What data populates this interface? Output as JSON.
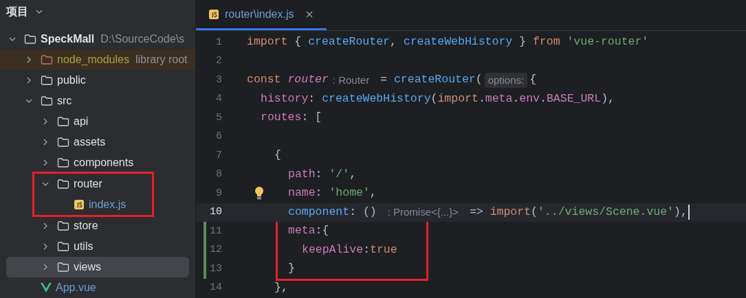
{
  "sidebar": {
    "title": "项目",
    "tree": [
      {
        "name": "SpeckMall",
        "hint": "D:\\SourceCode\\s",
        "kind": "folder",
        "expanded": true,
        "selected": false,
        "boxed": false,
        "children": [
          {
            "name": "node_modules",
            "hint": "library root",
            "kind": "excluded",
            "expanded": false,
            "selected": false,
            "boxed": false
          },
          {
            "name": "public",
            "kind": "folder",
            "expanded": false,
            "selected": false,
            "boxed": false
          },
          {
            "name": "src",
            "kind": "folder",
            "expanded": true,
            "selected": false,
            "boxed": false,
            "children": [
              {
                "name": "api",
                "kind": "folder",
                "expanded": false,
                "selected": false,
                "boxed": false
              },
              {
                "name": "assets",
                "kind": "folder",
                "expanded": false,
                "selected": false,
                "boxed": false
              },
              {
                "name": "components",
                "kind": "folder",
                "expanded": false,
                "selected": false,
                "boxed": false
              },
              {
                "name": "router",
                "kind": "folder",
                "expanded": true,
                "selected": false,
                "boxed": true,
                "children": [
                  {
                    "name": "index.js",
                    "kind": "js",
                    "selected": false,
                    "boxed": false
                  }
                ]
              },
              {
                "name": "store",
                "kind": "folder",
                "expanded": false,
                "selected": false,
                "boxed": false
              },
              {
                "name": "utils",
                "kind": "folder",
                "expanded": false,
                "selected": false,
                "boxed": false
              },
              {
                "name": "views",
                "kind": "folder",
                "expanded": false,
                "selected": true,
                "boxed": false
              }
            ]
          },
          {
            "name": "App.vue",
            "kind": "vue",
            "selected": false,
            "boxed": false
          }
        ]
      }
    ]
  },
  "editor": {
    "tabs": [
      {
        "label": "router\\index.js",
        "kind": "js",
        "selected": true
      }
    ],
    "lines": [
      {
        "number": "1",
        "current": false,
        "modified": false,
        "bulb": false,
        "boxed": false,
        "tokens": [
          {
            "text": "import ",
            "kind": "keyword"
          },
          {
            "text": "{ ",
            "kind": "plain"
          },
          {
            "text": "createRouter",
            "kind": "function"
          },
          {
            "text": ", ",
            "kind": "plain"
          },
          {
            "text": "createWebHistory",
            "kind": "function"
          },
          {
            "text": " } ",
            "kind": "plain"
          },
          {
            "text": "from ",
            "kind": "keyword"
          },
          {
            "text": "'vue-router'",
            "kind": "string"
          }
        ]
      },
      {
        "number": "2",
        "current": false,
        "modified": false,
        "bulb": false,
        "boxed": false
      },
      {
        "number": "3",
        "current": false,
        "modified": false,
        "bulb": false,
        "boxed": false,
        "tokens": [
          {
            "text": "const ",
            "kind": "keyword"
          },
          {
            "text": "router",
            "kind": "variable"
          },
          {
            "text": ": Router",
            "kind": "hint"
          },
          {
            "text": " = ",
            "kind": "plain"
          },
          {
            "text": "createRouter",
            "kind": "function"
          },
          {
            "text": "(",
            "kind": "plain"
          },
          {
            "text": "options:",
            "kind": "param_hint"
          },
          {
            "text": "{",
            "kind": "plain"
          }
        ]
      },
      {
        "number": "4",
        "current": false,
        "modified": false,
        "bulb": false,
        "boxed": false,
        "tokens": [
          {
            "text": "history",
            "kind": "property"
          },
          {
            "text": ": ",
            "kind": "plain"
          },
          {
            "text": "createWebHistory",
            "kind": "function"
          },
          {
            "text": "(",
            "kind": "plain"
          },
          {
            "text": "import",
            "kind": "keyword"
          },
          {
            "text": ".",
            "kind": "plain"
          },
          {
            "text": "meta",
            "kind": "property"
          },
          {
            "text": ".",
            "kind": "plain"
          },
          {
            "text": "env",
            "kind": "property"
          },
          {
            "text": ".",
            "kind": "plain"
          },
          {
            "text": "BASE_URL",
            "kind": "property"
          },
          {
            "text": "),",
            "kind": "plain"
          }
        ]
      },
      {
        "number": "5",
        "current": false,
        "modified": false,
        "bulb": false,
        "boxed": false,
        "tokens": [
          {
            "text": "routes",
            "kind": "property"
          },
          {
            "text": ": [",
            "kind": "plain"
          }
        ]
      },
      {
        "number": "6",
        "current": false,
        "modified": false,
        "bulb": false,
        "boxed": false
      },
      {
        "number": "7",
        "current": false,
        "modified": false,
        "bulb": false,
        "boxed": false,
        "tokens": [
          {
            "text": "{",
            "kind": "plain"
          }
        ]
      },
      {
        "number": "8",
        "current": false,
        "modified": false,
        "bulb": false,
        "boxed": false,
        "tokens": [
          {
            "text": "path",
            "kind": "property"
          },
          {
            "text": ": ",
            "kind": "plain"
          },
          {
            "text": "'/'",
            "kind": "string"
          },
          {
            "text": ",",
            "kind": "plain"
          }
        ]
      },
      {
        "number": "9",
        "current": false,
        "modified": false,
        "bulb": true,
        "boxed": false,
        "tokens": [
          {
            "text": "name",
            "kind": "property"
          },
          {
            "text": ": ",
            "kind": "plain"
          },
          {
            "text": "'home'",
            "kind": "string"
          },
          {
            "text": ",",
            "kind": "plain"
          }
        ]
      },
      {
        "number": "10",
        "current": true,
        "modified": false,
        "bulb": false,
        "boxed": false,
        "tokens": [
          {
            "text": "component",
            "kind": "function"
          },
          {
            "text": ": () ",
            "kind": "plain"
          },
          {
            "text": ": Promise<{...}>",
            "kind": "hint"
          },
          {
            "text": " => ",
            "kind": "plain"
          },
          {
            "text": "import",
            "kind": "keyword"
          },
          {
            "text": "(",
            "kind": "plain"
          },
          {
            "text": "'../views/Scene.vue'",
            "kind": "string"
          },
          {
            "text": "),",
            "kind": "plain"
          }
        ]
      },
      {
        "number": "11",
        "current": false,
        "modified": true,
        "bulb": false,
        "boxed": true,
        "tokens": [
          {
            "text": "meta",
            "kind": "property"
          },
          {
            "text": ":{",
            "kind": "plain"
          }
        ]
      },
      {
        "number": "12",
        "current": false,
        "modified": true,
        "bulb": false,
        "boxed": true,
        "tokens": [
          {
            "text": "keepAlive",
            "kind": "property"
          },
          {
            "text": ":",
            "kind": "plain"
          },
          {
            "text": "true",
            "kind": "keyword"
          }
        ]
      },
      {
        "number": "13",
        "current": false,
        "modified": true,
        "bulb": false,
        "boxed": true,
        "tokens": [
          {
            "text": "}",
            "kind": "plain"
          }
        ]
      },
      {
        "number": "14",
        "current": false,
        "modified": false,
        "bulb": false,
        "boxed": false,
        "tokens": [
          {
            "text": "},",
            "kind": "plain"
          }
        ]
      }
    ]
  }
}
